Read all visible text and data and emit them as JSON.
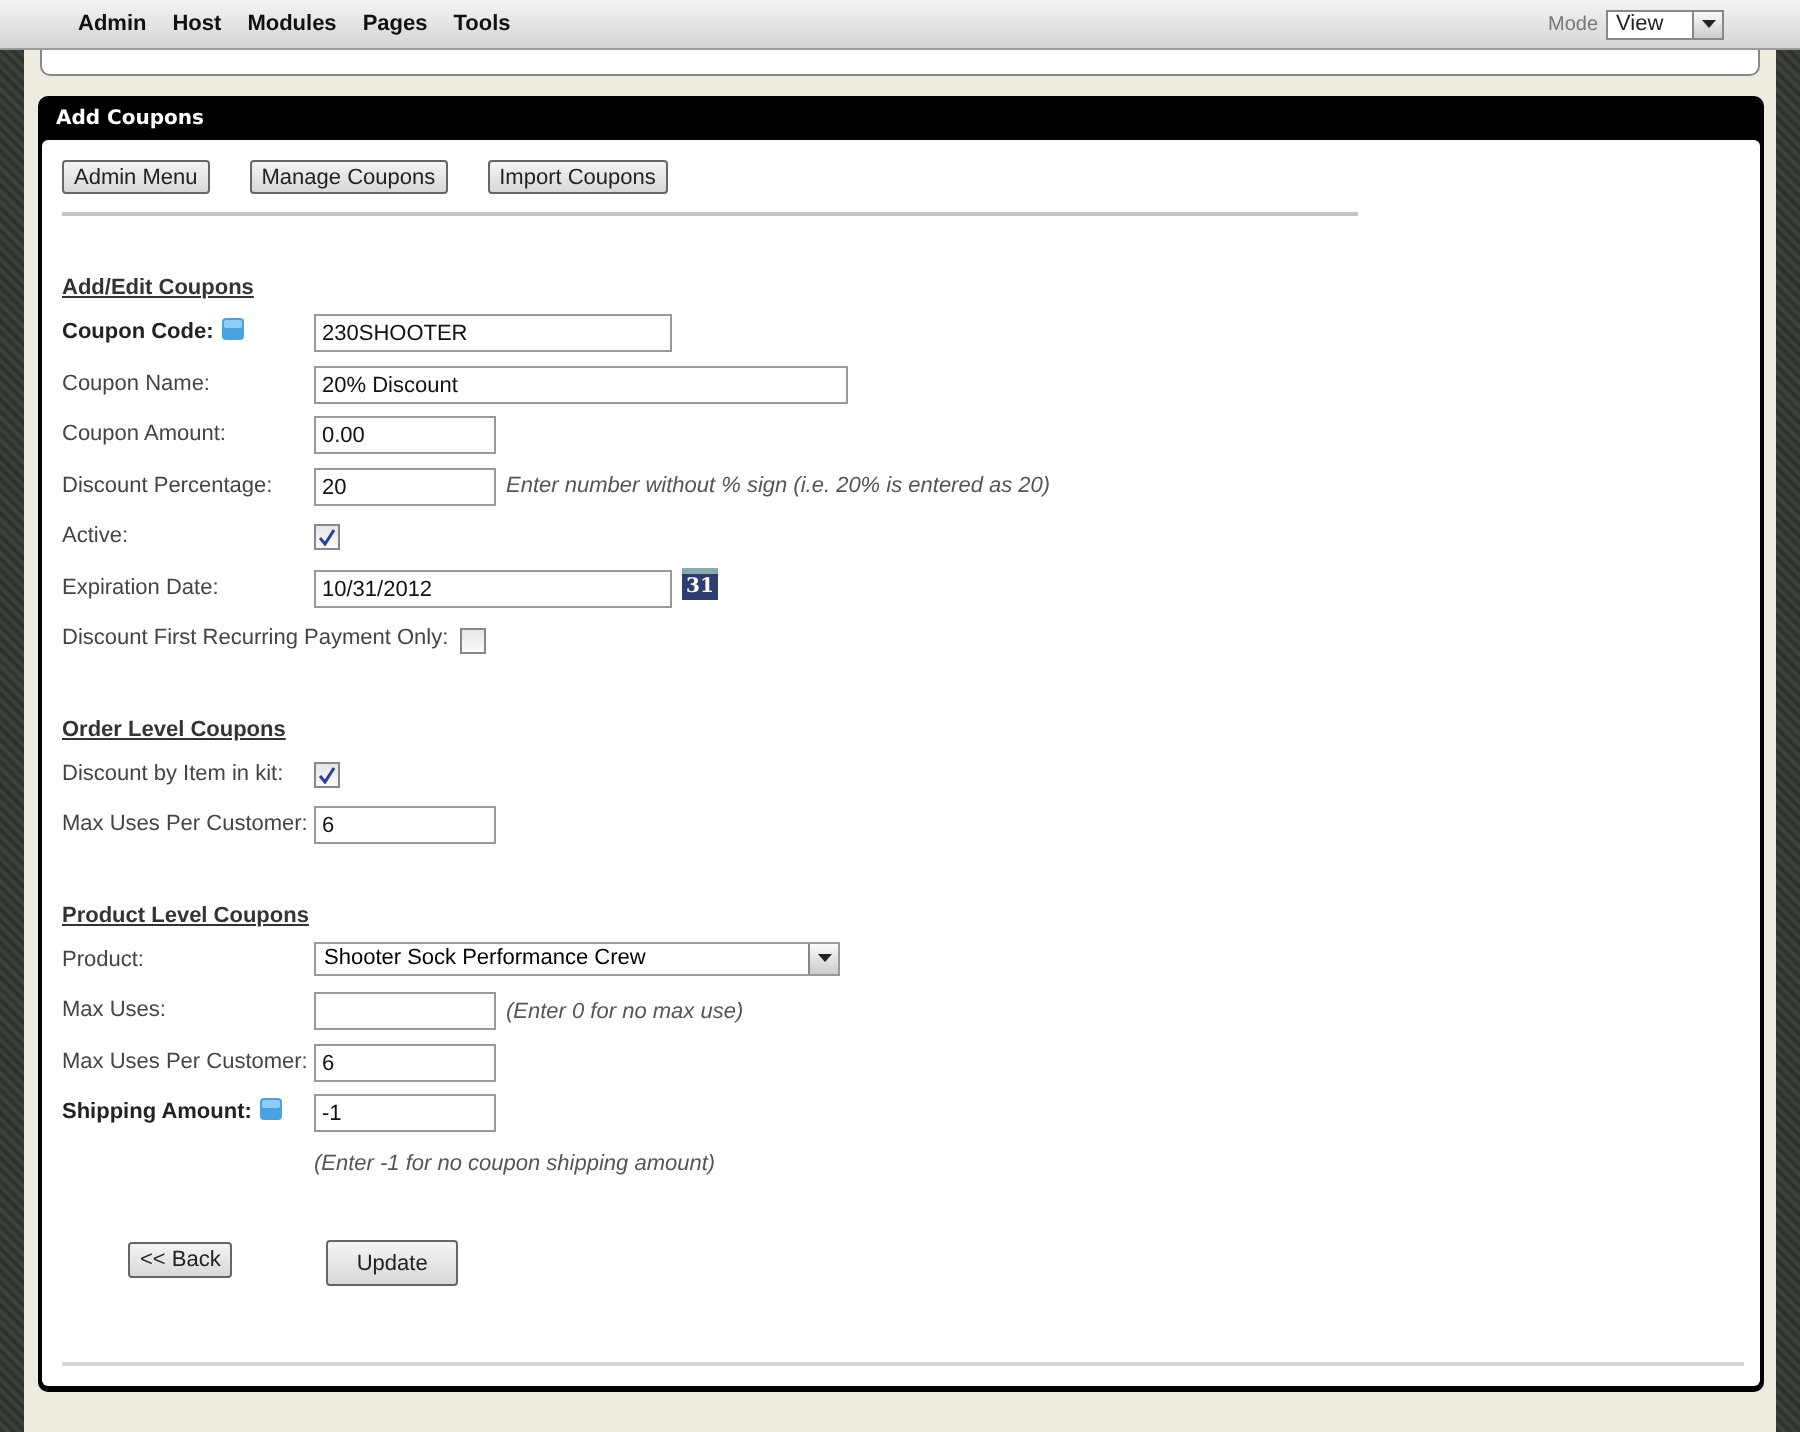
{
  "menu": [
    "Admin",
    "Host",
    "Modules",
    "Pages",
    "Tools"
  ],
  "mode": {
    "label": "Mode",
    "value": "View"
  },
  "panel": {
    "title": "Add Coupons"
  },
  "nav_buttons": [
    "Admin Menu",
    "Manage Coupons",
    "Import Coupons"
  ],
  "sections": [
    {
      "heading": "Add/Edit Coupons",
      "fields": [
        {
          "kind": "medium_text",
          "label": "Coupon Code:",
          "bold": true,
          "help": true,
          "value": "230SHOOTER"
        },
        {
          "kind": "long_text",
          "label": "Coupon Name:",
          "value": "20% Discount"
        },
        {
          "kind": "short_text",
          "label": "Coupon Amount:",
          "value": "0.00"
        },
        {
          "kind": "short_text",
          "label": "Discount Percentage:",
          "value": "20",
          "hint": "Enter number without % sign (i.e. 20% is entered as 20)"
        },
        {
          "kind": "checkbox",
          "label": "Active:",
          "checked": true
        },
        {
          "kind": "medium_text",
          "label": "Expiration Date:",
          "value": "10/31/2012",
          "calendar": "31"
        },
        {
          "kind": "inline_checkbox",
          "label": "Discount First Recurring Payment Only:",
          "checked": false
        }
      ]
    },
    {
      "heading": "Order Level Coupons",
      "fields": [
        {
          "kind": "checkbox",
          "label": "Discount by Item in kit:",
          "checked": true
        },
        {
          "kind": "short_text",
          "label": "Max Uses Per Customer:",
          "value": "6"
        }
      ]
    },
    {
      "heading": "Product Level Coupons",
      "fields": [
        {
          "kind": "select",
          "label": "Product:",
          "value": "Shooter Sock Performance Crew"
        },
        {
          "kind": "short_text",
          "label": "Max Uses:",
          "hint": "(Enter 0 for no max use)"
        },
        {
          "kind": "short_text",
          "label": "Max Uses Per Customer:",
          "value": "6"
        },
        {
          "kind": "short_text",
          "label": "Shipping Amount:",
          "bold": true,
          "help": true,
          "value": "-1"
        },
        {
          "kind": "note",
          "text": "(Enter -1 for no coupon shipping amount)"
        }
      ]
    }
  ],
  "actions": {
    "back": "<< Back",
    "update": "Update"
  }
}
